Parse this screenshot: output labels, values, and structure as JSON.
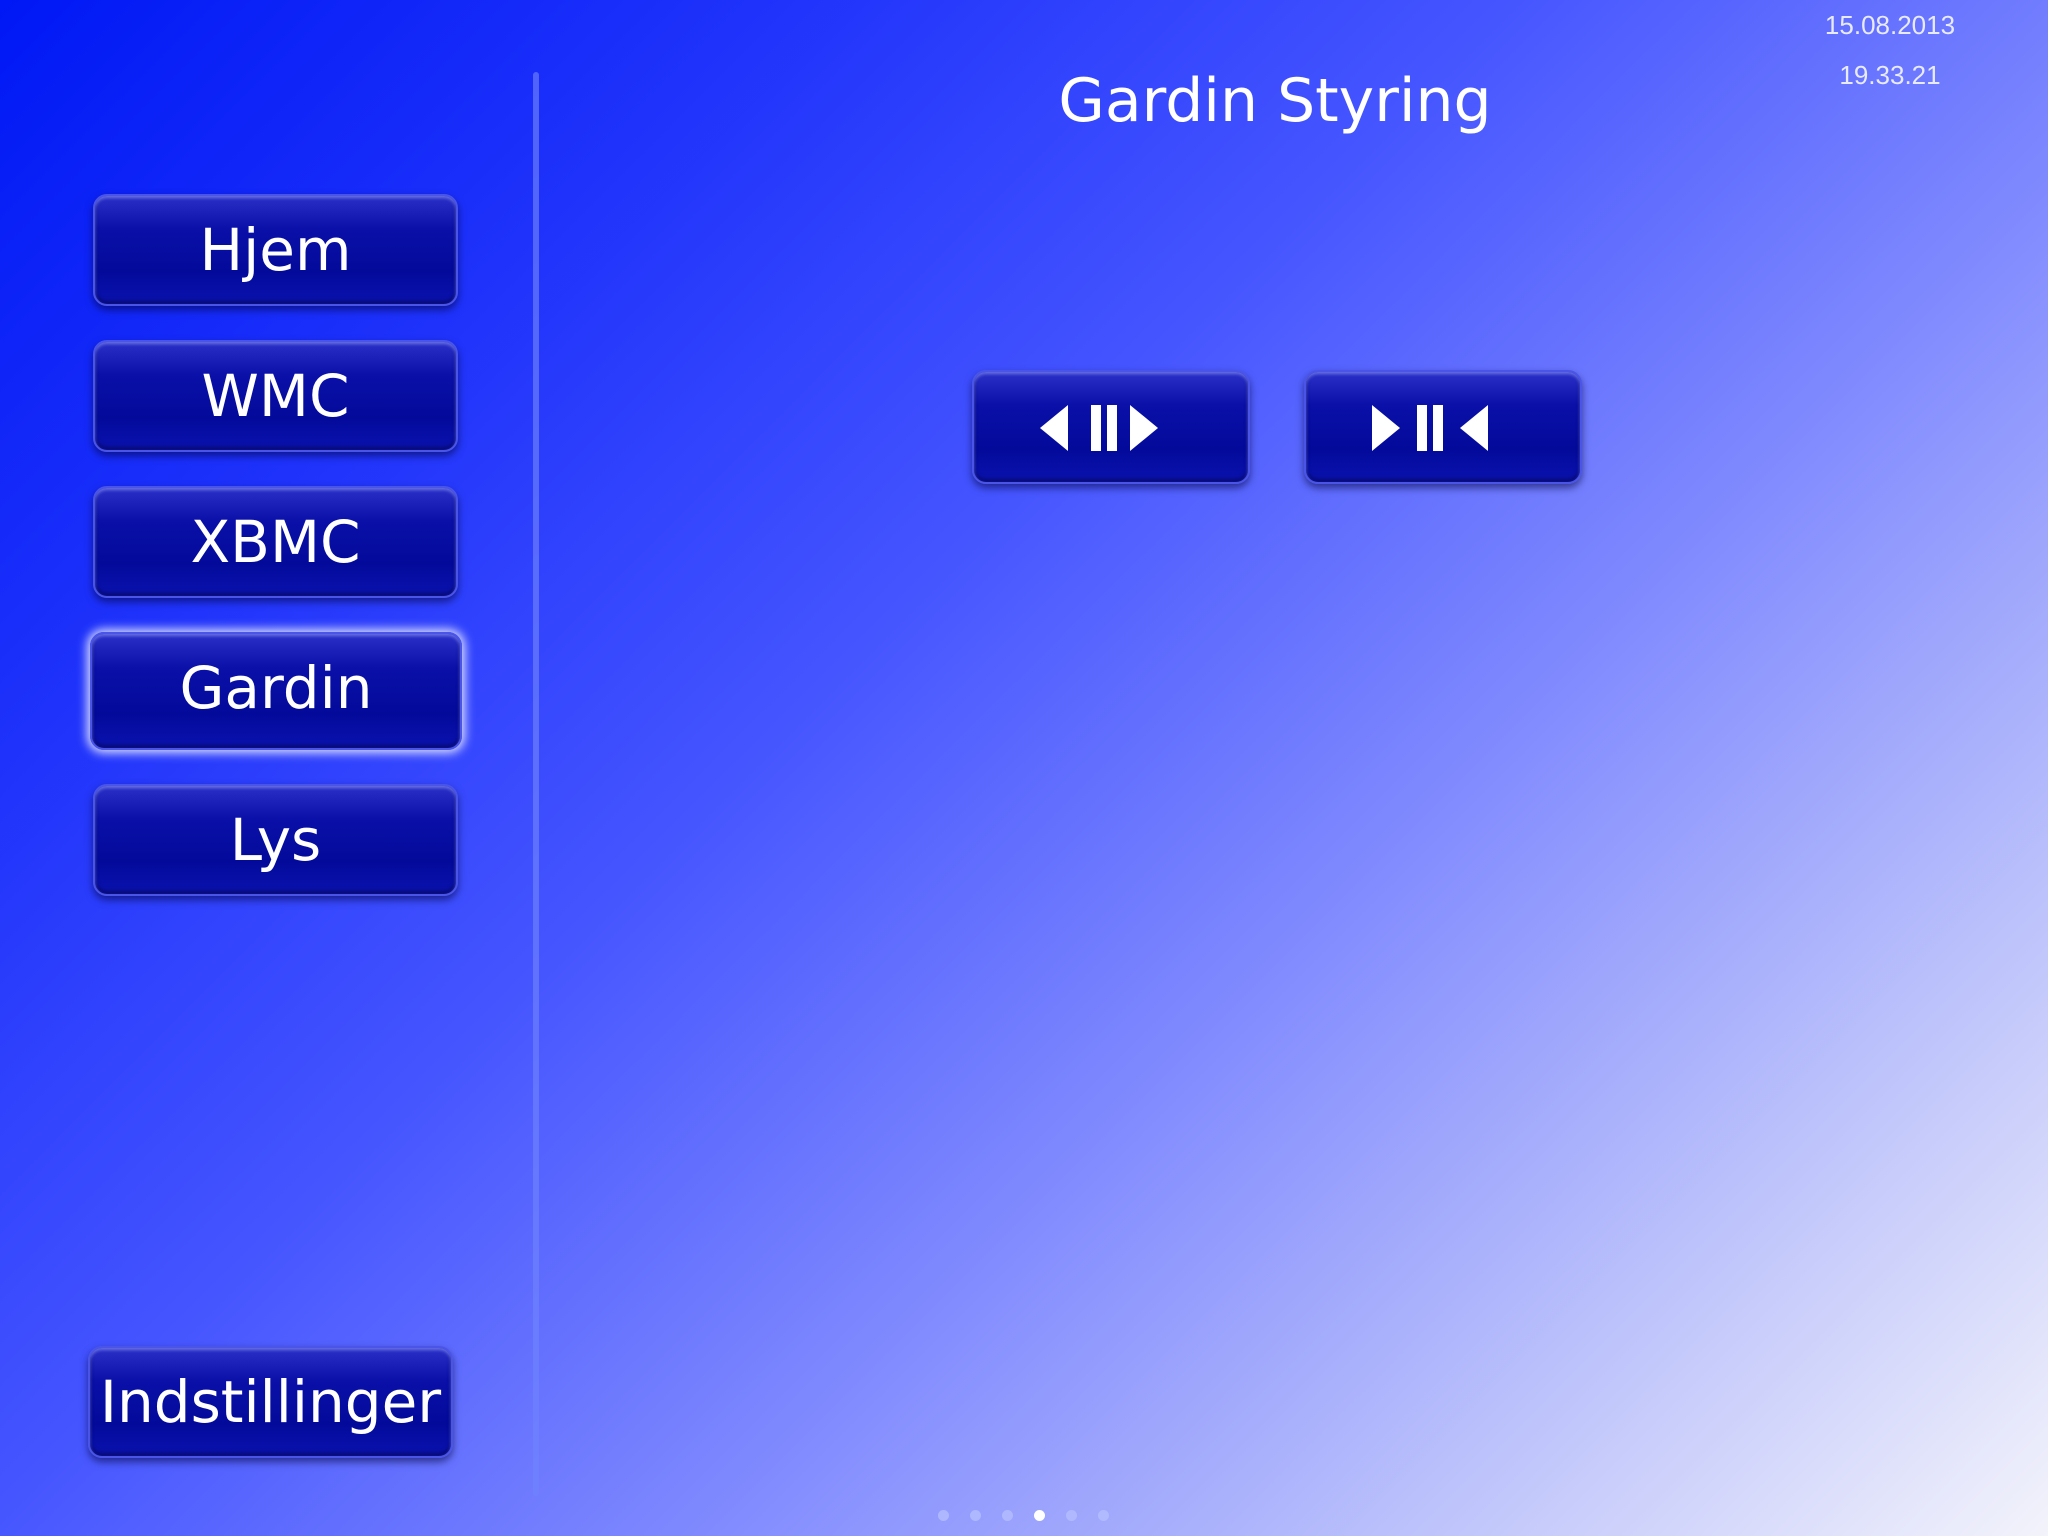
{
  "header": {
    "title": "Gardin Styring",
    "date": "15.08.2013",
    "time": "19.33.21"
  },
  "sidebar": {
    "items": [
      {
        "label": "Hjem"
      },
      {
        "label": "WMC"
      },
      {
        "label": "XBMC"
      },
      {
        "label": "Gardin",
        "active": true
      },
      {
        "label": "Lys"
      }
    ],
    "settings_label": "Indstillinger"
  },
  "controls": {
    "open_icon": "curtain-open-icon",
    "close_icon": "curtain-close-icon"
  },
  "pagination": {
    "pages": 6,
    "active_index": 3
  },
  "colors": {
    "accent": "#030a9a",
    "background_start": "#0018f5",
    "background_end": "#f3f3fb"
  }
}
